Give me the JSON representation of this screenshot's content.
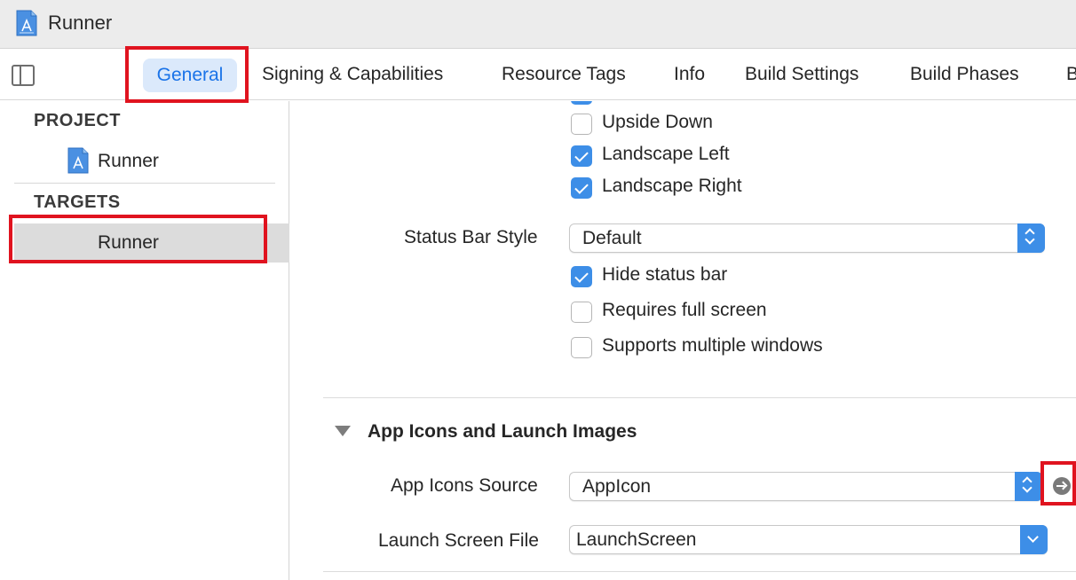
{
  "window": {
    "title": "Runner",
    "app_icon": "xcode-project-icon"
  },
  "tabs": [
    {
      "label": "General",
      "selected": true
    },
    {
      "label": "Signing & Capabilities"
    },
    {
      "label": "Resource Tags"
    },
    {
      "label": "Info"
    },
    {
      "label": "Build Settings"
    },
    {
      "label": "Build Phases"
    },
    {
      "label": "B"
    }
  ],
  "sidebar": {
    "project_header": "PROJECT",
    "project_item": "Runner",
    "targets_header": "TARGETS",
    "target_item": "Runner"
  },
  "orientation": {
    "upside_down": {
      "label": "Upside Down",
      "checked": false
    },
    "landscape_left": {
      "label": "Landscape Left",
      "checked": true
    },
    "landscape_right": {
      "label": "Landscape Right",
      "checked": true
    }
  },
  "status_bar": {
    "label": "Status Bar Style",
    "value": "Default",
    "hide": {
      "label": "Hide status bar",
      "checked": true
    },
    "full_screen": {
      "label": "Requires full screen",
      "checked": false
    },
    "multiple_windows": {
      "label": "Supports multiple windows",
      "checked": false
    }
  },
  "app_icons_section": {
    "title": "App Icons and Launch Images",
    "icons_source_label": "App Icons Source",
    "icons_source_value": "AppIcon",
    "launch_label": "Launch Screen File",
    "launch_value": "LaunchScreen"
  },
  "colors": {
    "accent": "#3d8ee7",
    "highlight": "#e0131f",
    "selected_tab_bg": "#dbe9fb"
  }
}
